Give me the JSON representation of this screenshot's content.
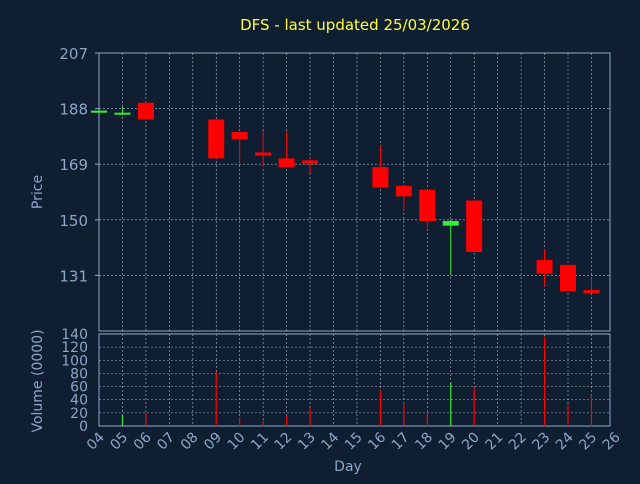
{
  "chart_data": [
    {
      "type": "candlestick",
      "title": "DFS - last updated 25/03/2026",
      "ylabel": "Price",
      "ylim": [
        112,
        207
      ],
      "yticks": [
        "207",
        "188",
        "169",
        "150",
        "131"
      ],
      "ytick_values": [
        207,
        188,
        169,
        150,
        131
      ],
      "grid": true,
      "up_color": "#33ee33",
      "down_color": "#ff0000",
      "candles": [
        {
          "day": "04",
          "open": 186.6,
          "close": 187.3,
          "high": 187.6,
          "low": 186.3
        },
        {
          "day": "05",
          "open": 186.3,
          "close": 186.6,
          "high": 188.6,
          "low": 185.9
        },
        {
          "day": "06",
          "open": 190.0,
          "close": 184.3,
          "high": 190.3,
          "low": 184.0
        },
        {
          "day": "09",
          "open": 184.3,
          "close": 171.0,
          "high": 184.6,
          "low": 171.0
        },
        {
          "day": "10",
          "open": 180.0,
          "close": 177.6,
          "high": 180.0,
          "low": 169.6
        },
        {
          "day": "11",
          "open": 173.0,
          "close": 172.0,
          "high": 180.3,
          "low": 168.0
        },
        {
          "day": "12",
          "open": 171.0,
          "close": 168.0,
          "high": 180.3,
          "low": 168.0
        },
        {
          "day": "13",
          "open": 170.3,
          "close": 169.3,
          "high": 171.0,
          "low": 166.0
        },
        {
          "day": "16",
          "open": 168.0,
          "close": 161.0,
          "high": 175.3,
          "low": 161.0
        },
        {
          "day": "17",
          "open": 161.6,
          "close": 158.0,
          "high": 161.6,
          "low": 153.3
        },
        {
          "day": "18",
          "open": 160.3,
          "close": 149.6,
          "high": 160.3,
          "low": 147.0
        },
        {
          "day": "19",
          "open": 148.0,
          "close": 149.6,
          "high": 150.0,
          "low": 131.3
        },
        {
          "day": "20",
          "open": 156.6,
          "close": 139.0,
          "high": 156.6,
          "low": 139.0
        },
        {
          "day": "23",
          "open": 136.3,
          "close": 131.6,
          "high": 140.0,
          "low": 127.3
        },
        {
          "day": "24",
          "open": 134.6,
          "close": 125.6,
          "high": 134.6,
          "low": 125.6
        },
        {
          "day": "25",
          "open": 126.0,
          "close": 125.0,
          "high": 130.3,
          "low": 125.0
        }
      ]
    },
    {
      "type": "bar",
      "ylabel": "Volume (0000)",
      "xlabel": "Day",
      "ylim": [
        0,
        140
      ],
      "yticks": [
        "140",
        "120",
        "100",
        "80",
        "60",
        "40",
        "20",
        "0"
      ],
      "ytick_values": [
        140,
        120,
        100,
        80,
        60,
        40,
        20,
        0
      ],
      "categories": [
        "04",
        "05",
        "06",
        "07",
        "08",
        "09",
        "10",
        "11",
        "12",
        "13",
        "14",
        "15",
        "16",
        "17",
        "18",
        "19",
        "20",
        "21",
        "22",
        "23",
        "24",
        "25",
        "26"
      ],
      "bars": [
        {
          "day": "05",
          "value": 17,
          "direction": "up"
        },
        {
          "day": "06",
          "value": 20,
          "direction": "down"
        },
        {
          "day": "09",
          "value": 82,
          "direction": "down"
        },
        {
          "day": "10",
          "value": 13,
          "direction": "down"
        },
        {
          "day": "11",
          "value": 8,
          "direction": "down"
        },
        {
          "day": "12",
          "value": 15,
          "direction": "down"
        },
        {
          "day": "13",
          "value": 27,
          "direction": "down"
        },
        {
          "day": "16",
          "value": 54,
          "direction": "down"
        },
        {
          "day": "17",
          "value": 35,
          "direction": "down"
        },
        {
          "day": "18",
          "value": 19,
          "direction": "down"
        },
        {
          "day": "19",
          "value": 66,
          "direction": "up"
        },
        {
          "day": "20",
          "value": 59,
          "direction": "down"
        },
        {
          "day": "23",
          "value": 136,
          "direction": "down"
        },
        {
          "day": "24",
          "value": 32,
          "direction": "down"
        },
        {
          "day": "25",
          "value": 47,
          "direction": "down"
        }
      ]
    }
  ],
  "colors": {
    "background": "#0f1e30",
    "axis": "#8aa6c8",
    "grid": "#b0b8c8",
    "title": "#ffff33",
    "label": "#8aa6c8"
  }
}
